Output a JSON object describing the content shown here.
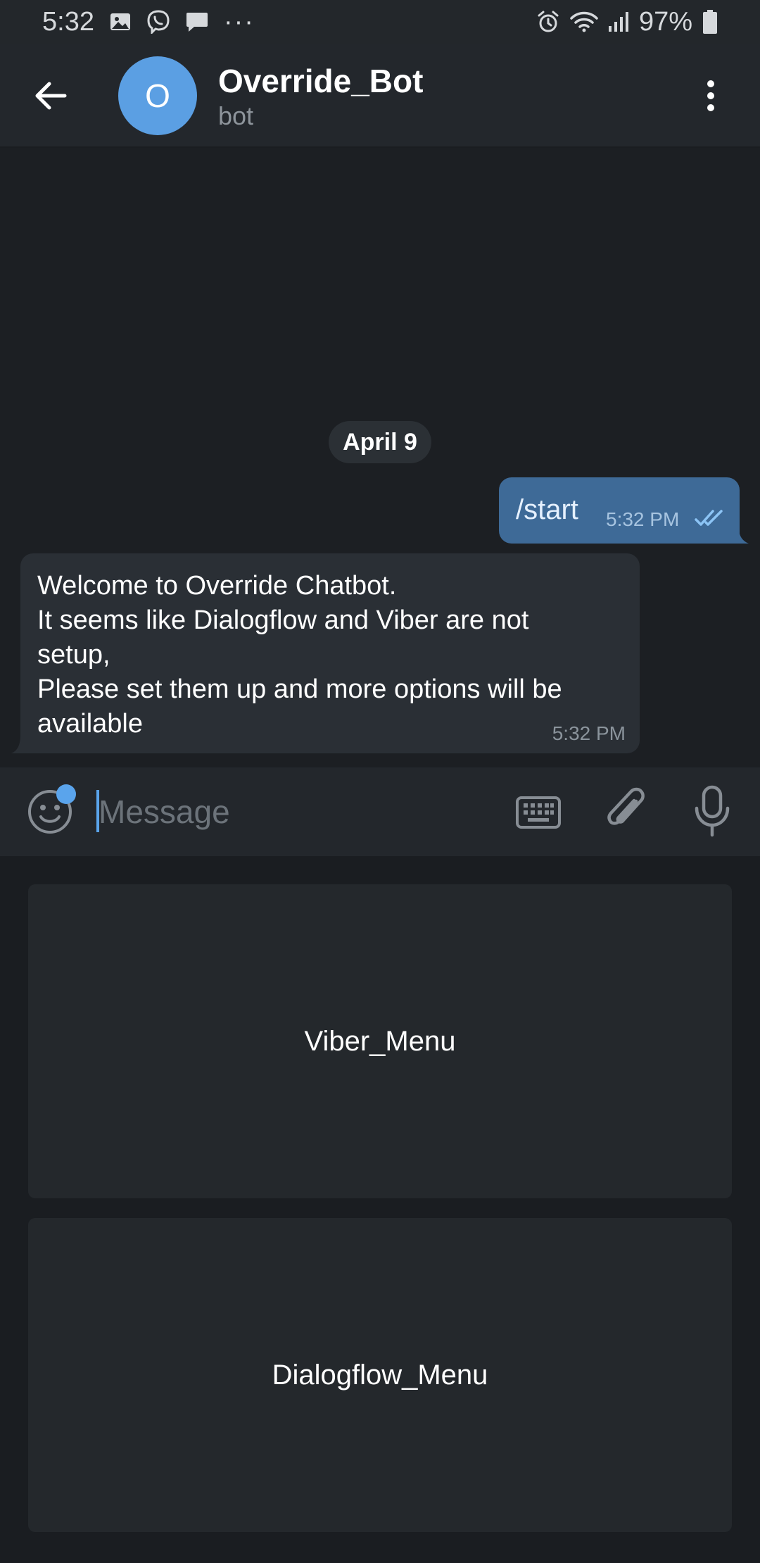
{
  "status_bar": {
    "time": "5:32",
    "battery": "97%",
    "overflow": "···",
    "left_icons": [
      "image-icon",
      "viber-icon",
      "message-icon",
      "more-notifications-icon"
    ],
    "right_icons": [
      "alarm-icon",
      "wifi-icon",
      "signal-icon",
      "battery-icon"
    ]
  },
  "header": {
    "avatar_letter": "O",
    "title": "Override_Bot",
    "subtitle": "bot",
    "avatar_color": "#5b9fe3"
  },
  "chat": {
    "date": "April 9",
    "outgoing": {
      "text": "/start",
      "time": "5:32 PM",
      "status": "read"
    },
    "incoming": {
      "lines": [
        "Welcome to Override Chatbot.",
        "It seems like Dialogflow and Viber are not",
        "setup,",
        "Please set them up and more options will be",
        "available"
      ],
      "time": "5:32 PM"
    }
  },
  "input": {
    "placeholder": "Message",
    "value": ""
  },
  "keyboard": {
    "buttons": [
      {
        "label": "Viber_Menu"
      },
      {
        "label": "Dialogflow_Menu"
      }
    ]
  },
  "colors": {
    "accent": "#5aa4ec",
    "outgoing_bubble": "#3e6a97",
    "incoming_bubble": "#2a2f35",
    "background": "#1c1f23"
  }
}
